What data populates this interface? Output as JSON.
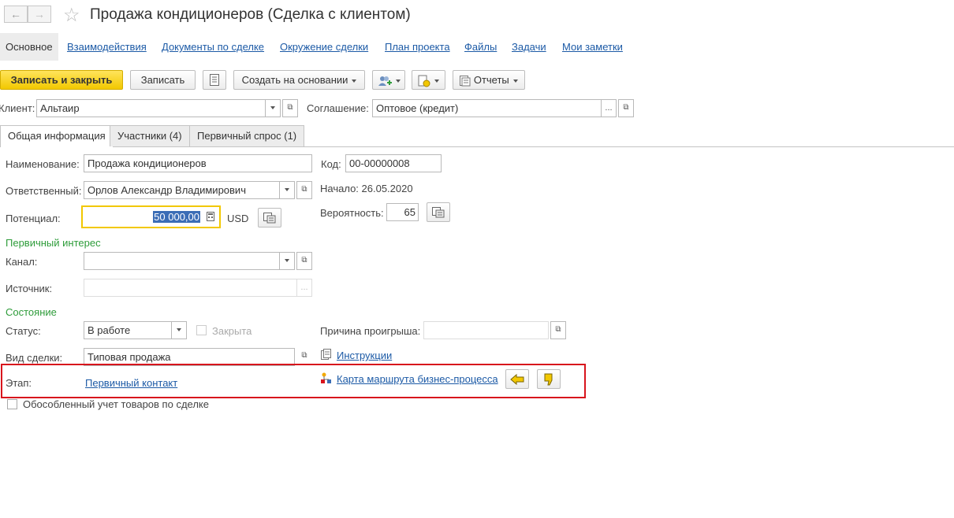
{
  "window": {
    "title": "Продажа кондиционеров (Сделка с клиентом)",
    "back": "←",
    "forward": "→",
    "star": "☆"
  },
  "nav": {
    "items": [
      {
        "label": "Основное",
        "active": true
      },
      {
        "label": "Взаимодействия"
      },
      {
        "label": "Документы по сделке"
      },
      {
        "label": "Окружение сделки"
      },
      {
        "label": "План проекта"
      },
      {
        "label": "Файлы"
      },
      {
        "label": "Задачи"
      },
      {
        "label": "Мои заметки"
      }
    ]
  },
  "toolbar": {
    "save_close": "Записать и закрыть",
    "save": "Записать",
    "create_based": "Создать на основании",
    "reports": "Отчеты"
  },
  "header_fields": {
    "client_label": "Клиент:",
    "client_value": "Альтаир",
    "agreement_label": "Соглашение:",
    "agreement_value": "Оптовое (кредит)",
    "ellipsis": "..."
  },
  "tabs": [
    {
      "label": "Общая информация",
      "active": true
    },
    {
      "label": "Участники (4)"
    },
    {
      "label": "Первичный спрос (1)"
    }
  ],
  "form": {
    "name_label": "Наименование:",
    "name_value": "Продажа кондиционеров",
    "code_label": "Код:",
    "code_value": "00-00000008",
    "responsible_label": "Ответственный:",
    "responsible_value": "Орлов Александр Владимирович",
    "start_text": "Начало: 26.05.2020",
    "potential_label": "Потенциал:",
    "potential_value": "50 000,00",
    "currency": "USD",
    "probability_label": "Вероятность:",
    "probability_value": "65",
    "primary_interest_section": "Первичный интерес",
    "channel_label": "Канал:",
    "channel_value": "",
    "source_label": "Источник:",
    "source_value": "",
    "state_section": "Состояние",
    "status_label": "Статус:",
    "status_value": "В работе",
    "closed_label": "Закрыта",
    "loss_reason_label": "Причина проигрыша:",
    "loss_reason_value": "",
    "deal_type_label": "Вид сделки:",
    "deal_type_value": "Типовая продажа",
    "instructions_link": "Инструкции",
    "stage_label": "Этап:",
    "stage_value": "Первичный контакт",
    "route_map_link": "Карта маршрута бизнес-процесса",
    "separate_accounting_label": "Обособленный учет товаров по сделке"
  },
  "colors": {
    "accent_yellow": "#f2c800",
    "link": "#1c5aa6",
    "section_green": "#2e9c3a",
    "highlight_red": "#d8141c"
  }
}
